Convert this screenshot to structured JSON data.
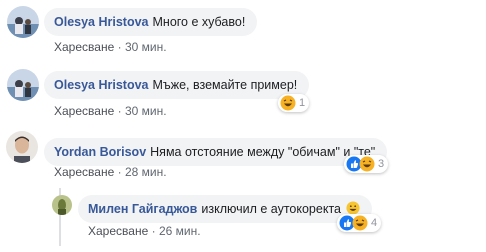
{
  "comments": [
    {
      "author": "Olesya Hristova",
      "text": "Много е хубаво!",
      "like_label": "Харесване",
      "separator": "·",
      "time": "30 мин."
    },
    {
      "author": "Olesya Hristova",
      "text": "Мъже, вземайте пример!",
      "like_label": "Харесване",
      "separator": "·",
      "time": "30 мин.",
      "reaction_count": "1",
      "reaction_icons": [
        "haha-icon"
      ]
    },
    {
      "author": "Yordan Borisov",
      "text": "Няма отстояние между \"обичам\" и \"те\"",
      "like_label": "Харесване",
      "separator": "·",
      "time": "28 мин.",
      "reaction_count": "3",
      "reaction_icons": [
        "like-icon",
        "haha-icon"
      ]
    },
    {
      "author": "Милен Гайгаджов",
      "text": "изключил е аутокоректа",
      "emoji": "😀",
      "like_label": "Харесване",
      "separator": "·",
      "time": "26 мин.",
      "reaction_count": "4",
      "reaction_icons": [
        "like-icon",
        "haha-icon"
      ]
    }
  ],
  "colors": {
    "author": "#385898",
    "bubble": "#f2f3f5",
    "like_blue": "#1877f2",
    "haha_yellow": "#f7b125"
  }
}
